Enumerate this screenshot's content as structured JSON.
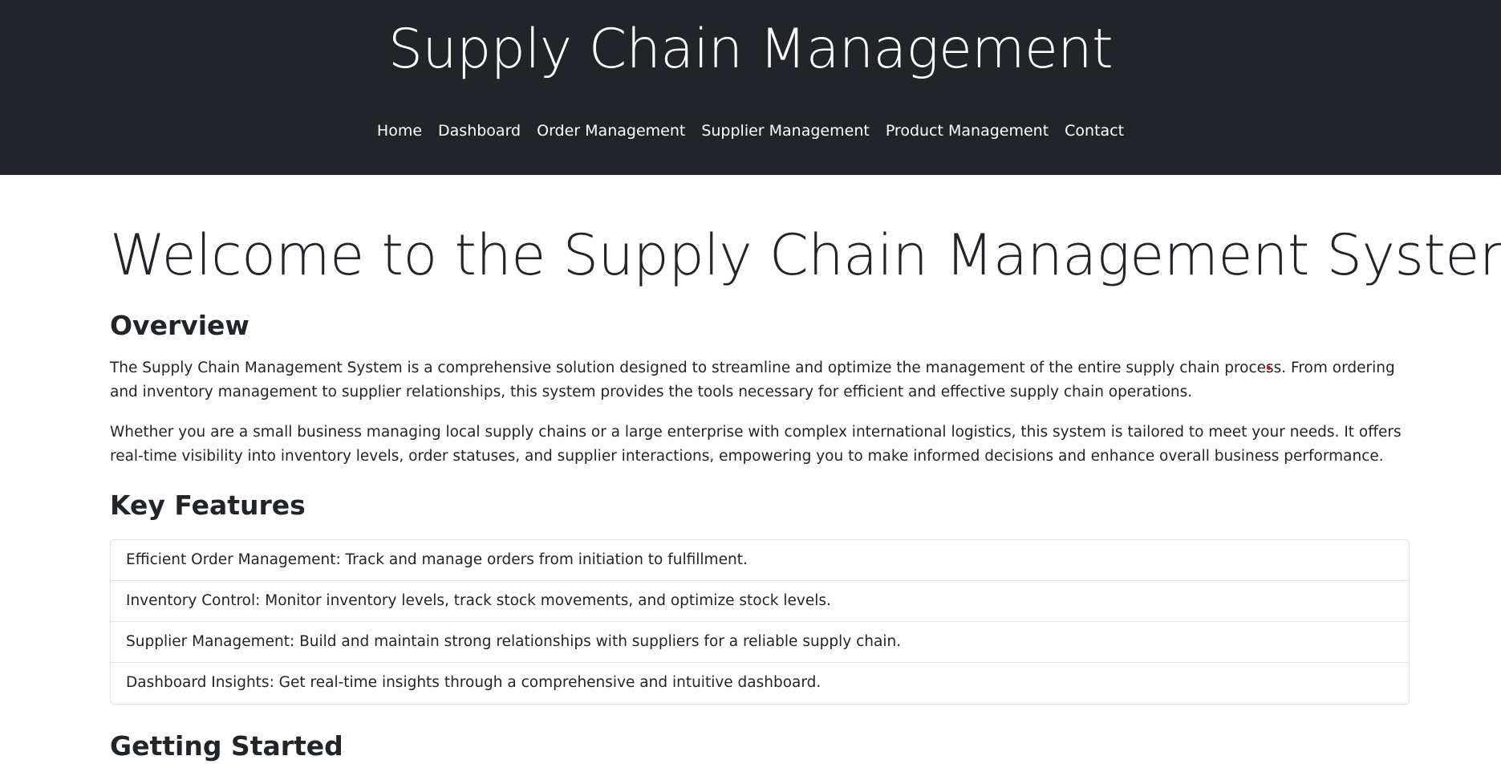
{
  "header": {
    "title": "Supply Chain Management",
    "nav": [
      {
        "label": "Home"
      },
      {
        "label": "Dashboard"
      },
      {
        "label": "Order Management"
      },
      {
        "label": "Supplier Management"
      },
      {
        "label": "Product Management"
      },
      {
        "label": "Contact"
      }
    ]
  },
  "main": {
    "hero_title": "Welcome to the Supply Chain Management System",
    "overview": {
      "title": "Overview",
      "paragraphs": [
        "The Supply Chain Management System is a comprehensive solution designed to streamline and optimize the management of the entire supply chain process. From ordering and inventory management to supplier relationships, this system provides the tools necessary for efficient and effective supply chain operations.",
        "Whether you are a small business managing local supply chains or a large enterprise with complex international logistics, this system is tailored to meet your needs. It offers real-time visibility into inventory levels, order statuses, and supplier interactions, empowering you to make informed decisions and enhance overall business performance."
      ]
    },
    "features": {
      "title": "Key Features",
      "items": [
        "Efficient Order Management: Track and manage orders from initiation to fulfillment.",
        "Inventory Control: Monitor inventory levels, track stock movements, and optimize stock levels.",
        "Supplier Management: Build and maintain strong relationships with suppliers for a reliable supply chain.",
        "Dashboard Insights: Get real-time insights through a comprehensive and intuitive dashboard."
      ]
    },
    "getting_started": {
      "title": "Getting Started"
    }
  },
  "colors": {
    "header_bg": "#212529",
    "header_text": "#ffffff",
    "body_text": "#212529",
    "border": "#dee2e6",
    "cursor_dot": "#cc1a1a"
  }
}
